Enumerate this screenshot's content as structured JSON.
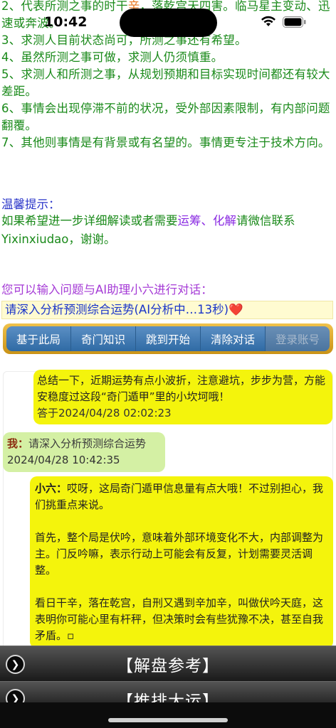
{
  "status_bar": {
    "time": "10:42",
    "wifi_icon": "wifi-icon",
    "battery_icon": "battery-icon"
  },
  "result": {
    "line1_pre": "2、代表所测之事的时干",
    "line1_hl": "辛",
    "line1_post": "，落乾宫天四害。临马星主变动、迅速或奔波。",
    "line3": "3、求测人目前状态尚可，所测之事还有希望。",
    "line4": "4、虽然所测之事可做，求测人仍须慎重。",
    "line5": "5、求测人和所测之事，从规划预期和目标实现时间都还有较大差距。",
    "line6": "6、事情会出现停滞不前的状况，受外部因素限制，有内部问题翻覆。",
    "line7": "7、其他则事情是有背景或有名望的。事情更专注于技术方向。"
  },
  "tip": {
    "title": "温馨提示：",
    "text_pre": "如果希望进一步详细解读或者需要",
    "link1": "运筹",
    "sep": "、",
    "link2": "化解",
    "text_post": "请微信联系Yixinxiudao，谢谢。"
  },
  "ai_prompt": "您可以输入问题与AI助理小六进行对话：",
  "query_text": "请深入分析预测综合运势(AI分析中…13秒)❤️",
  "toolbar": {
    "buttons": [
      "基于此局",
      "奇门知识",
      "跳到开始",
      "清除对话",
      "登录账号"
    ]
  },
  "chat": {
    "ai_msg_1": {
      "text": "总结一下，近期运势有点小波折，注意避坑，步步为营，方能安稳度过这段“奇门遁甲”里的小坎坷哦！",
      "time": "答于2024/04/28 02:02:23"
    },
    "user_msg": {
      "who": "我：",
      "text": "请深入分析预测综合运势",
      "time": "2024/04/28 10:42:35"
    },
    "ai_msg_2": {
      "name": "小六：",
      "p1": "哎呀，这局奇门遁甲信息量有点大哦！不过别担心，我们挑重点来说。",
      "p2": "首先，整个局是伏吟，意味着外部环境变化不大，内部调整为主。门反吟嘛，表示行动上可能会有反复，计划需要灵活调整。",
      "p3": "看日干辛，落在乾宫，自刑又遇到辛加辛，叫做伏吟天庭，这表明你可能心里有杆秤，但决策时会有些犹豫不决，甚至自我矛盾。▫"
    }
  },
  "sections": {
    "jiepan": "【解盘参考】",
    "tuipai": "【推排大运】",
    "icon": "chevron-right-icon"
  }
}
